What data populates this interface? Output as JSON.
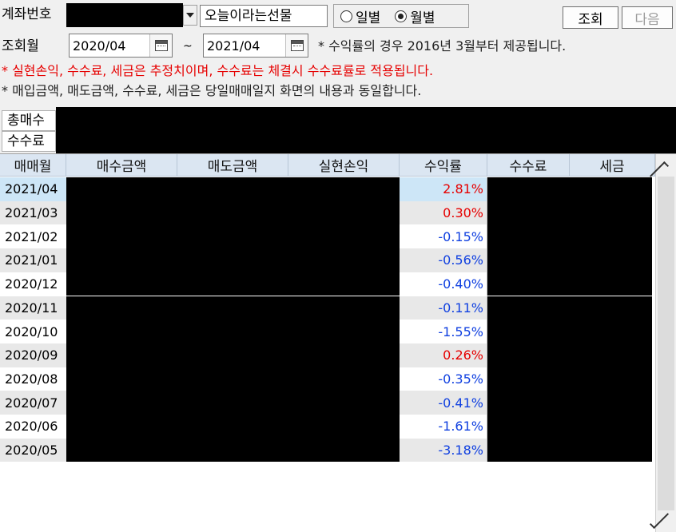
{
  "header": {
    "account_label": "계좌번호",
    "account_name": "오늘이라는선물",
    "period_options": [
      {
        "label": "일별",
        "selected": false
      },
      {
        "label": "월별",
        "selected": true
      }
    ],
    "query_button": "조회",
    "next_button": "다음"
  },
  "query": {
    "label": "조회월",
    "from": "2020/04",
    "tilde": "~",
    "to": "2021/04",
    "note": "* 수익률의 경우 2016년 3월부터 제공됩니다."
  },
  "notes": {
    "red": "* 실현손익, 수수료, 세금은 추정치이며, 수수료는 체결시 수수료률로 적용됩니다.",
    "dark": "* 매입금액, 매도금액, 수수료, 세금은 당일매매일지 화면의 내용과 동일합니다."
  },
  "summary": {
    "total_label": "총매수",
    "fee_label": "수수료"
  },
  "table": {
    "columns": [
      "매매월",
      "매수금액",
      "매도금액",
      "실현손익",
      "수익률",
      "수수료",
      "세금"
    ],
    "rows": [
      {
        "month": "2021/04",
        "rate": "2.81%",
        "sign": "pos"
      },
      {
        "month": "2021/03",
        "rate": "0.30%",
        "sign": "pos"
      },
      {
        "month": "2021/02",
        "rate": "-0.15%",
        "sign": "neg"
      },
      {
        "month": "2021/01",
        "rate": "-0.56%",
        "sign": "neg"
      },
      {
        "month": "2020/12",
        "rate": "-0.40%",
        "sign": "neg"
      },
      {
        "month": "2020/11",
        "rate": "-0.11%",
        "sign": "neg"
      },
      {
        "month": "2020/10",
        "rate": "-1.55%",
        "sign": "neg"
      },
      {
        "month": "2020/09",
        "rate": "0.26%",
        "sign": "pos"
      },
      {
        "month": "2020/08",
        "rate": "-0.35%",
        "sign": "neg"
      },
      {
        "month": "2020/07",
        "rate": "-0.41%",
        "sign": "neg"
      },
      {
        "month": "2020/06",
        "rate": "-1.61%",
        "sign": "neg"
      },
      {
        "month": "2020/05",
        "rate": "-3.18%",
        "sign": "neg"
      }
    ]
  },
  "colors": {
    "positive": "#e60000",
    "negative": "#1040e0",
    "header_bg": "#dbe6f2",
    "selected_row": "#cde6f7"
  }
}
